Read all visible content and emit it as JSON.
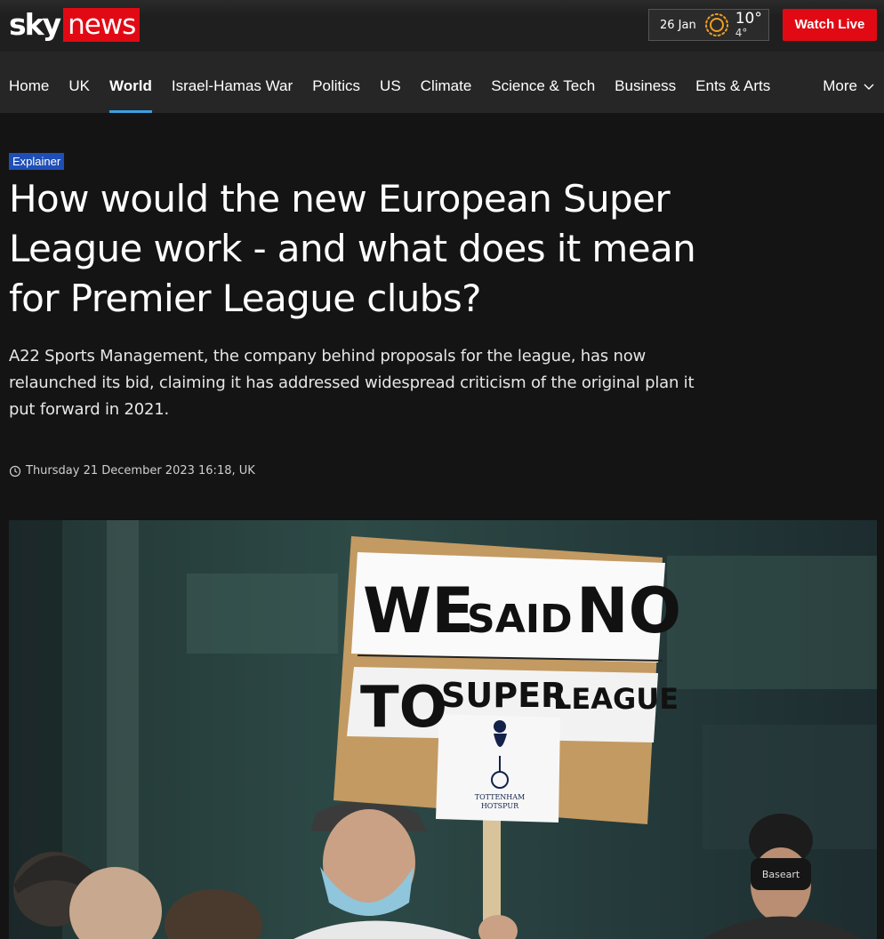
{
  "header": {
    "logo": {
      "sky": "sky",
      "news": "news"
    },
    "weather": {
      "date": "26 Jan",
      "high": "10°",
      "low": "4°",
      "icon": "sun-icon"
    },
    "watch_live": "Watch Live"
  },
  "nav": {
    "items": [
      {
        "label": "Home"
      },
      {
        "label": "UK"
      },
      {
        "label": "World",
        "active": true
      },
      {
        "label": "Israel-Hamas War"
      },
      {
        "label": "Politics"
      },
      {
        "label": "US"
      },
      {
        "label": "Climate"
      },
      {
        "label": "Science & Tech"
      },
      {
        "label": "Business"
      },
      {
        "label": "Ents & Arts"
      }
    ],
    "more": "More"
  },
  "article": {
    "tag": "Explainer",
    "headline": "How would the new European Super League work - and what does it mean for Premier League clubs?",
    "standfirst": "A22 Sports Management, the company behind proposals for the league, has now relaunched its bid, claiming it has addressed widespread criticism of the original plan it put forward in 2021.",
    "timestamp": "Thursday 21 December 2023 16:18, UK",
    "hero_image": {
      "sign": {
        "line1": [
          "WE",
          "SAID",
          "NO"
        ],
        "line2": [
          "TO",
          "SUPER",
          "LEAGUE"
        ],
        "crest_text": [
          "TOTTENHAM",
          "HOTSPUR"
        ]
      },
      "mask_text": "Baseart"
    }
  },
  "colors": {
    "brand_red": "#e10a14",
    "nav_active": "#3aa0e0",
    "tag_blue": "#1f4fb6"
  }
}
